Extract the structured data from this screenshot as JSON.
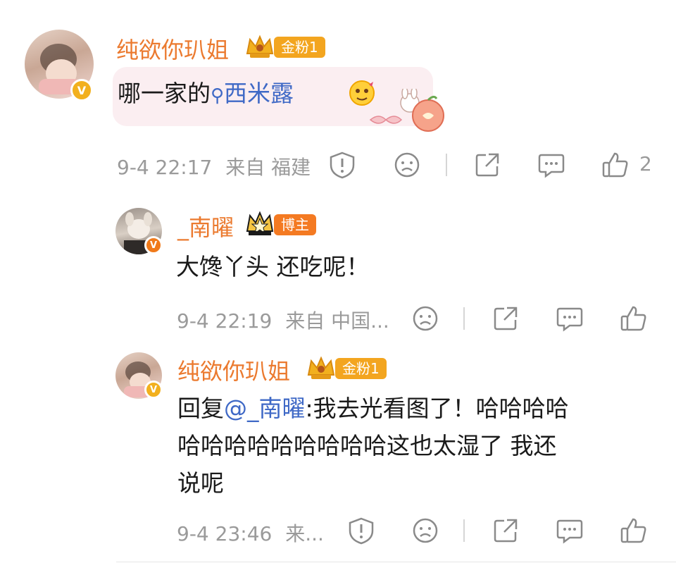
{
  "comments": [
    {
      "username": "纯欲你玐姐",
      "badge": "金粉1",
      "text_prefix": "哪一家的",
      "topic": "西米露",
      "time": "9-4 22:17",
      "location": "来自 福建",
      "likes": "2"
    }
  ],
  "replies": [
    {
      "username": "_南曜",
      "badge": "博主",
      "text": "大馋丫头 还吃呢！",
      "time": "9-4 22:19",
      "location": "来自 中国..."
    },
    {
      "username": "纯欲你玐姐",
      "badge": "金粉1",
      "reply_prefix": "回复",
      "mention": "@_南曜",
      "text_line1": ":我去光看图了！哈哈哈哈",
      "text_line2": "哈哈哈哈哈哈哈哈哈这也太湿了 我还",
      "text_line3": "说呢",
      "time": "9-4 23:46",
      "location": "来..."
    }
  ],
  "colors": {
    "username": "#eb7a2f",
    "link": "#3f69c6",
    "meta": "#9a9a9a",
    "gold": "#f2b01e",
    "blogger_tag": "#f47a22"
  }
}
